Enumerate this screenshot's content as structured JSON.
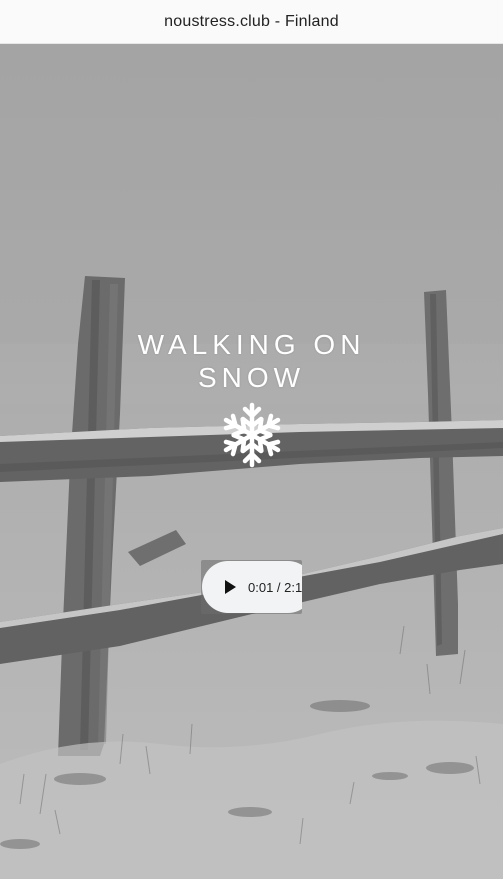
{
  "header": {
    "title": "noustress.club - Finland"
  },
  "hero": {
    "title": "WALKING ON SNOW",
    "background": "snowy field with wooden fence (grayscale)",
    "icon": "snowflake-icon"
  },
  "audio": {
    "current_time": "0:01",
    "duration": "2:1",
    "time_display": "0:01 / 2:1",
    "play_icon": "play-icon"
  },
  "colors": {
    "header_bg": "#fafafa",
    "scene_gray": "#a9a9a9",
    "title_color": "#ffffff",
    "player_bg": "#f1f3f4"
  }
}
